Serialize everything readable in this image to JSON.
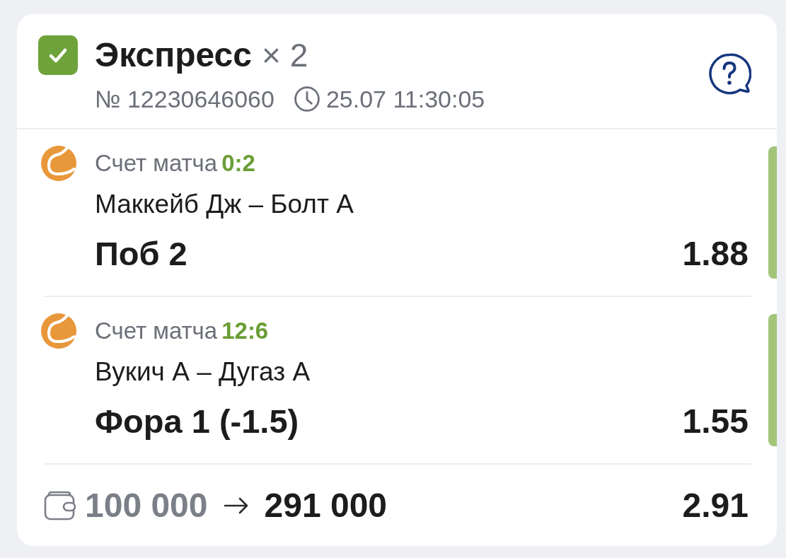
{
  "bet": {
    "type": "Экспресс",
    "won": true,
    "multiplier": "× 2",
    "number": "№ 12230646060",
    "datetime": "25.07 11:30:05"
  },
  "selections": [
    {
      "label": "Счет матча",
      "score": "0:2",
      "match": "Маккейб Дж – Болт А",
      "pick": "Поб 2",
      "odds": "1.88",
      "won": true
    },
    {
      "label": "Счет матча",
      "score": "12:6",
      "match": "Вукич А – Дугаз А",
      "pick": "Фора 1 (-1.5)",
      "odds": "1.55",
      "won": true
    }
  ],
  "footer": {
    "stake": "100 000",
    "payout": "291 000",
    "total_odds": "2.91"
  }
}
